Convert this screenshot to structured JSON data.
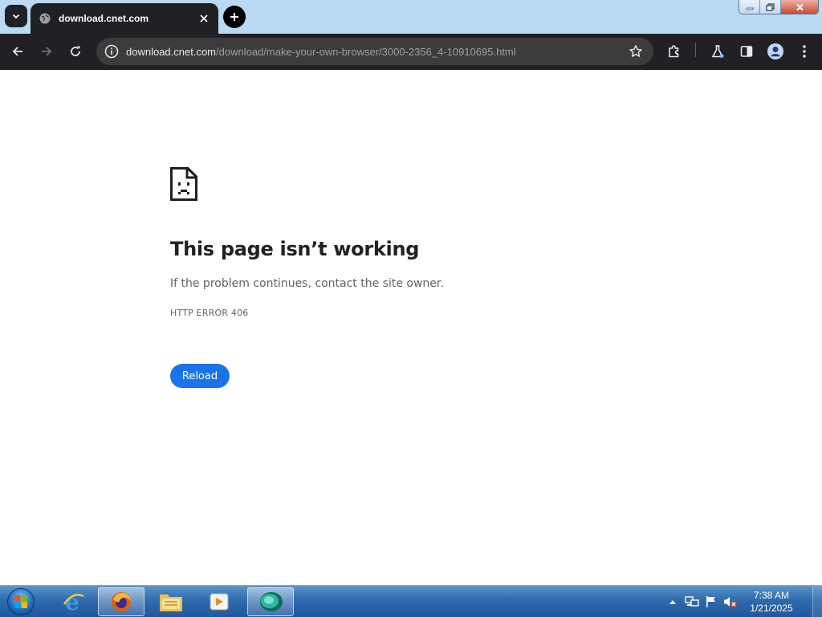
{
  "browser": {
    "tab": {
      "title": "download.cnet.com"
    },
    "address_bar": {
      "host": "download.cnet.com",
      "path": "/download/make-your-own-browser/3000-2356_4-10910695.html"
    }
  },
  "page": {
    "title": "This page isn’t working",
    "description": "If the problem continues, contact the site owner.",
    "error_code": "HTTP ERROR 406",
    "reload_label": "Reload"
  },
  "taskbar": {
    "apps": [
      "start-orb",
      "internet-explorer-icon",
      "firefox-icon",
      "file-explorer-icon",
      "media-player-icon",
      "chrome-icon"
    ],
    "clock": {
      "time": "7:38 AM",
      "date": "1/21/2025"
    }
  },
  "colors": {
    "accent": "#1a73e8",
    "toolbar_bg": "#202124",
    "titlebar_bg": "#b9d9f5"
  }
}
